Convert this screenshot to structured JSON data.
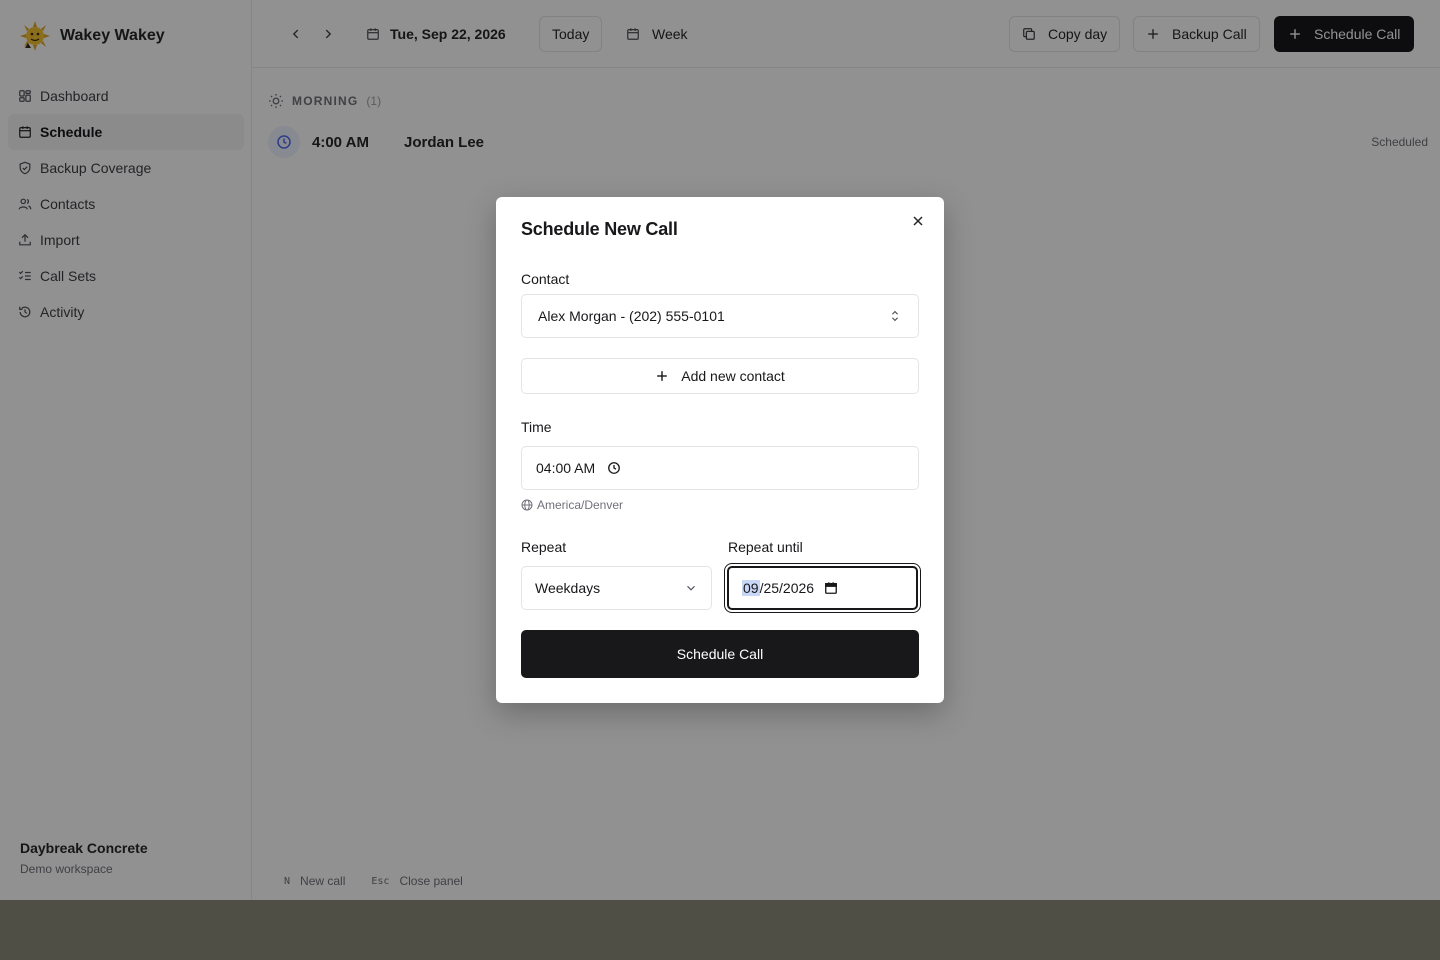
{
  "app": {
    "name": "Wakey Wakey"
  },
  "sidebar": {
    "items": [
      {
        "label": "Dashboard",
        "icon": "dashboard-icon"
      },
      {
        "label": "Schedule",
        "icon": "calendar-icon",
        "active": true
      },
      {
        "label": "Backup Coverage",
        "icon": "shield-check-icon"
      },
      {
        "label": "Contacts",
        "icon": "users-icon"
      },
      {
        "label": "Import",
        "icon": "upload-icon"
      },
      {
        "label": "Call Sets",
        "icon": "list-checks-icon"
      },
      {
        "label": "Activity",
        "icon": "history-icon"
      }
    ],
    "workspace": {
      "name": "Daybreak Concrete",
      "subtitle": "Demo workspace"
    }
  },
  "topbar": {
    "date": "Tue, Sep 22, 2026",
    "today_label": "Today",
    "view_label": "Week",
    "copy_day_label": "Copy day",
    "backup_call_label": "Backup Call",
    "schedule_call_label": "Schedule Call"
  },
  "schedule": {
    "section": {
      "title": "MORNING",
      "count": "(1)"
    },
    "calls": [
      {
        "time": "4:00 AM",
        "name": "Jordan Lee",
        "status": "Scheduled"
      }
    ]
  },
  "shortcuts": [
    {
      "key": "N",
      "label": "New call"
    },
    {
      "key": "Esc",
      "label": "Close panel"
    }
  ],
  "modal": {
    "title": "Schedule New Call",
    "contact_label": "Contact",
    "contact_value": "Alex Morgan - (202) 555-0101",
    "add_contact_label": "Add new contact",
    "time_label": "Time",
    "time_value": "04:00 AM",
    "timezone": "America/Denver",
    "repeat_label": "Repeat",
    "repeat_value": "Weekdays",
    "repeat_until_label": "Repeat until",
    "repeat_until_month": "09",
    "repeat_until_rest": "/25/2026",
    "submit_label": "Schedule Call"
  },
  "colors": {
    "primary": "#18181b",
    "overlay": "rgba(0,0,0,0.43)",
    "accent_clock": "#4f6bed"
  }
}
